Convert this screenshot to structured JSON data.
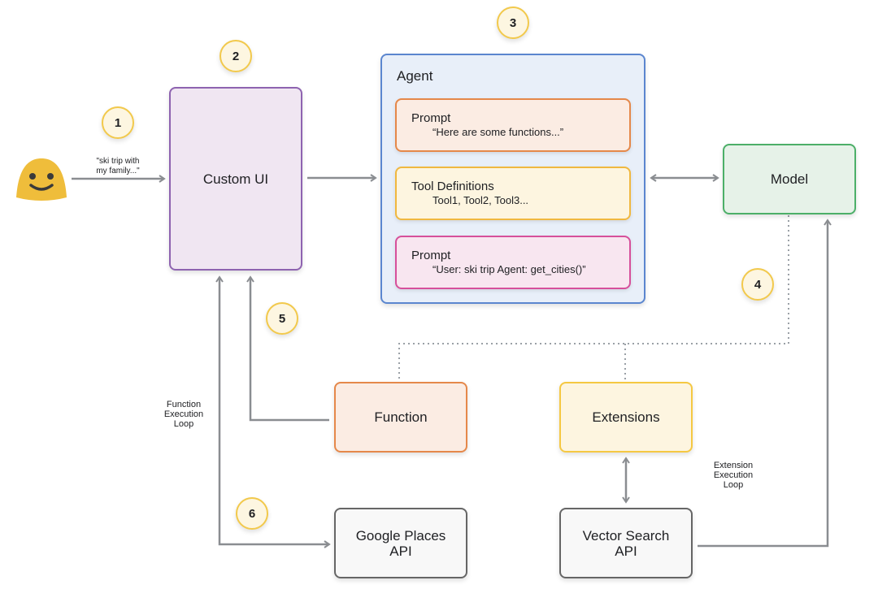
{
  "user_message": "\"ski trip with\nmy family...\"",
  "steps": [
    "1",
    "2",
    "3",
    "4",
    "5",
    "6"
  ],
  "custom_ui": {
    "label": "Custom UI"
  },
  "agent": {
    "title": "Agent",
    "blocks": [
      {
        "title": "Prompt",
        "text": "“Here are some functions...”"
      },
      {
        "title": "Tool Definitions",
        "text": "Tool1, Tool2, Tool3..."
      },
      {
        "title": "Prompt",
        "text": "“User: ski trip Agent: get_cities()”"
      }
    ]
  },
  "model": {
    "label": "Model"
  },
  "function": {
    "label": "Function"
  },
  "extensions": {
    "label": "Extensions"
  },
  "google_places": {
    "label": "Google Places\nAPI"
  },
  "vector_search": {
    "label": "Vector Search\nAPI"
  },
  "function_loop_label": "Function\nExecution\nLoop",
  "extension_loop_label": "Extension\nExecution\nLoop",
  "colors": {
    "purple": "#8e63b0",
    "blue": "#5b86cf",
    "orange": "#e5884a",
    "yellow": "#f2c94c",
    "pink": "#d6509b",
    "green": "#4caf68",
    "gray": "#666666",
    "arrow": "#8a8d91"
  },
  "icons": {
    "user": "smiley-face-icon"
  }
}
